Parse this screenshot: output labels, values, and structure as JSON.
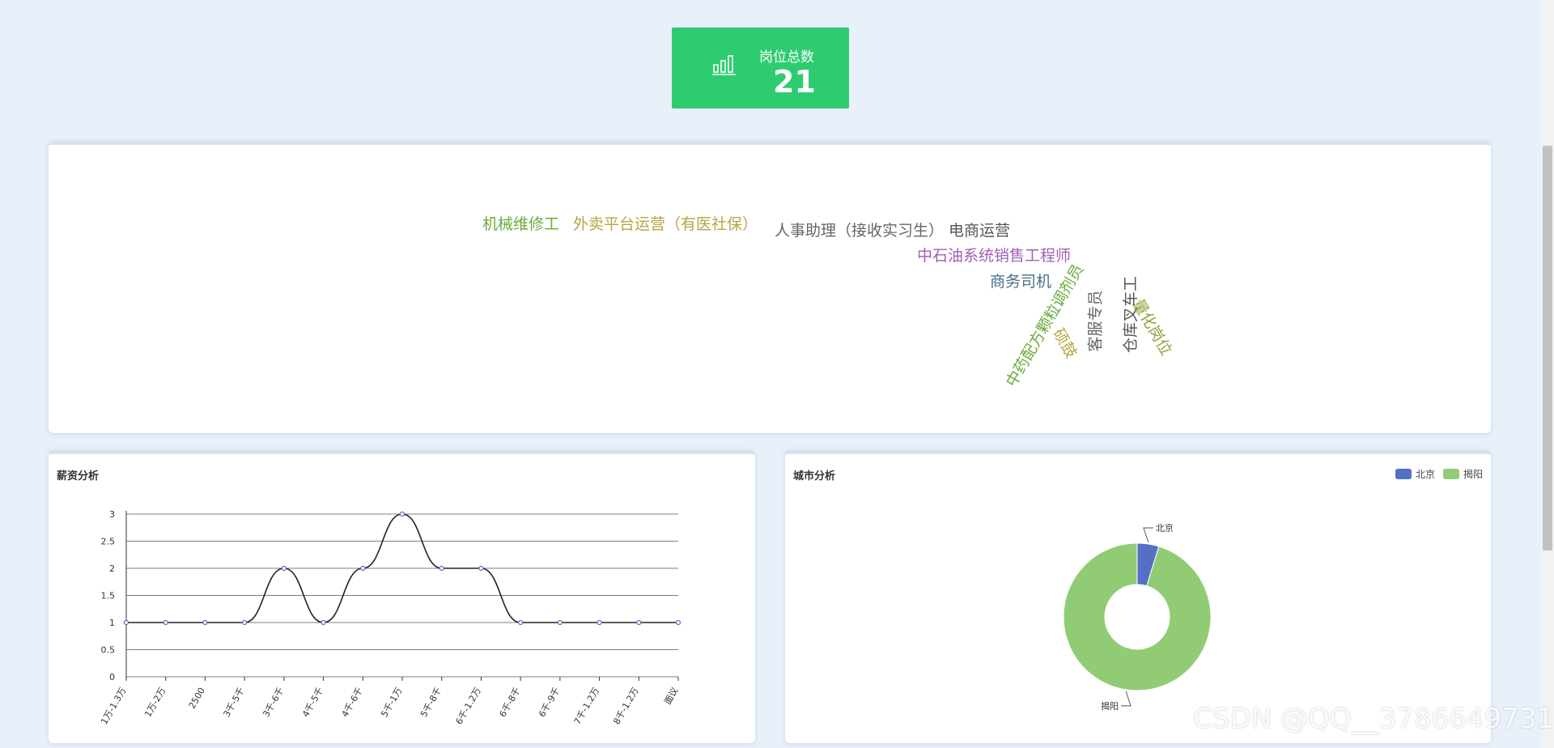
{
  "stat": {
    "label": "岗位总数",
    "value": "21",
    "icon": "bar-chart-icon",
    "bg": "#2ecc71"
  },
  "word_cloud": {
    "words": [
      {
        "text": "机械维修工",
        "color": "#6aaa3a"
      },
      {
        "text": "外卖平台运营（有医社保）",
        "color": "#b5a642"
      },
      {
        "text": "人事助理（接收实习生）",
        "color": "#666666"
      },
      {
        "text": "电商运营",
        "color": "#555555"
      },
      {
        "text": "中石油系统销售工程师",
        "color": "#a05fb5"
      },
      {
        "text": "商务司机",
        "color": "#4a6f8a"
      },
      {
        "text": "中药配方颗粒调剂员",
        "color": "#6aaa3a"
      },
      {
        "text": "硕鼓",
        "color": "#b5a642"
      },
      {
        "text": "客服专员",
        "color": "#666666"
      },
      {
        "text": "仓库叉车工",
        "color": "#555555"
      },
      {
        "text": "量化岗位",
        "color": "#8aa23a"
      }
    ]
  },
  "salary": {
    "title": "薪资分析",
    "chart_data": {
      "type": "line",
      "categories": [
        "1万-1.3万",
        "1万-2万",
        "2500",
        "3千-5千",
        "3千-6千",
        "4千-5千",
        "4千-6千",
        "5千-1万",
        "5千-8千",
        "6千-1.2万",
        "6千-8千",
        "6千-9千",
        "7千-1.2万",
        "8千-1.2万",
        "面议"
      ],
      "values": [
        1,
        1,
        1,
        1,
        2,
        1,
        2,
        3,
        2,
        2,
        1,
        1,
        1,
        1,
        1
      ],
      "yticks": [
        "0",
        "0.5",
        "1",
        "1.5",
        "2",
        "2.5",
        "3"
      ],
      "ylim": [
        0,
        3
      ],
      "line_color": "#222222",
      "point_color": "#5b6bc0"
    }
  },
  "city": {
    "title": "城市分析",
    "legend": [
      {
        "name": "北京",
        "color": "#5470c6"
      },
      {
        "name": "揭阳",
        "color": "#91cc75"
      }
    ],
    "chart_data": {
      "type": "pie",
      "slices": [
        {
          "name": "北京",
          "value": 1
        },
        {
          "name": "揭阳",
          "value": 20
        }
      ]
    }
  },
  "watermark": "CSDN @QQ__3786649731"
}
